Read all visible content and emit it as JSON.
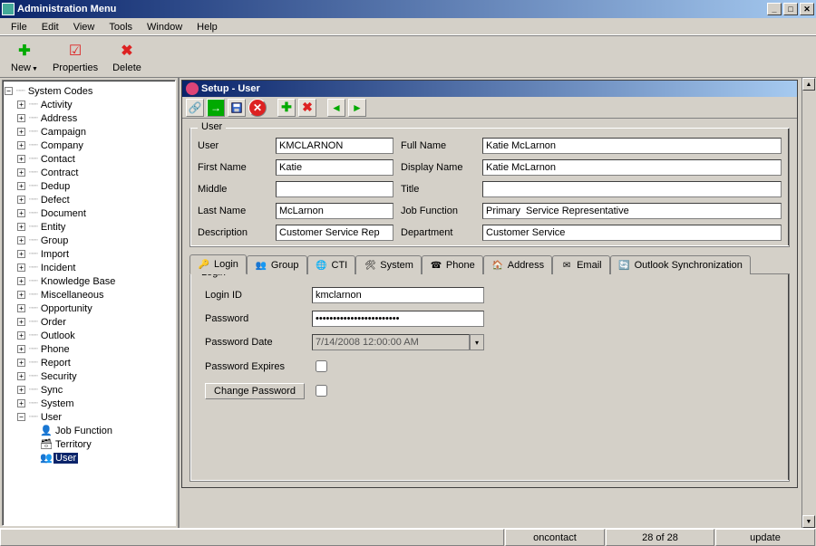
{
  "window": {
    "title": "Administration Menu"
  },
  "menubar": [
    "File",
    "Edit",
    "View",
    "Tools",
    "Window",
    "Help"
  ],
  "toolbar": {
    "new": "New",
    "properties": "Properties",
    "delete": "Delete"
  },
  "tree": {
    "root": "System Codes",
    "items": [
      "Activity",
      "Address",
      "Campaign",
      "Company",
      "Contact",
      "Contract",
      "Dedup",
      "Defect",
      "Document",
      "Entity",
      "Group",
      "Import",
      "Incident",
      "Knowledge Base",
      "Miscellaneous",
      "Opportunity",
      "Order",
      "Outlook",
      "Phone",
      "Report",
      "Security",
      "Sync",
      "System"
    ],
    "user_node": "User",
    "user_children": [
      "Job Function",
      "Territory",
      "User"
    ],
    "selected": "User"
  },
  "subwindow": {
    "title": "Setup - User"
  },
  "user": {
    "labels": {
      "user": "User",
      "fullname": "Full Name",
      "firstname": "First Name",
      "displayname": "Display Name",
      "middle": "Middle",
      "title": "Title",
      "lastname": "Last Name",
      "jobfunction": "Job Function",
      "description": "Description",
      "department": "Department"
    },
    "values": {
      "user": "KMCLARNON",
      "fullname": "Katie McLarnon",
      "firstname": "Katie",
      "displayname": "Katie McLarnon",
      "middle": "",
      "title": "",
      "lastname": "McLarnon",
      "jobfunction": "Primary  Service Representative",
      "description": "Customer Service Rep",
      "department": "Customer Service"
    },
    "legend": "User"
  },
  "tabs": [
    "Login",
    "Group",
    "CTI",
    "System",
    "Phone",
    "Address",
    "Email",
    "Outlook Synchronization"
  ],
  "login": {
    "legend": "Login",
    "labels": {
      "loginid": "Login ID",
      "password": "Password",
      "passworddate": "Password Date",
      "passwordexpires": "Password Expires",
      "changepassword": "Change Password"
    },
    "values": {
      "loginid": "kmclarnon",
      "password": "************************",
      "passworddate": "7/14/2008 12:00:00 AM"
    }
  },
  "statusbar": {
    "contact": "oncontact",
    "count": "28 of 28",
    "mode": "update"
  }
}
